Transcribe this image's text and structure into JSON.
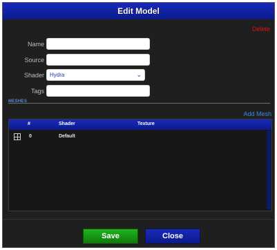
{
  "dialog": {
    "title": "Edit Model",
    "delete_label": "Delete"
  },
  "form": {
    "name_label": "Name",
    "name_value": "",
    "source_label": "Source",
    "source_value": "",
    "shader_label": "Shader",
    "shader_value": "Hydra",
    "tags_label": "Tags",
    "tags_value": ""
  },
  "meshes": {
    "section_label": "MESHES",
    "add_label": "Add Mesh",
    "columns": [
      "#",
      "Shader",
      "Texture"
    ],
    "rows": [
      {
        "index": "0",
        "shader": "Default",
        "texture": ""
      }
    ]
  },
  "footer": {
    "save_label": "Save",
    "close_label": "Close"
  },
  "colors": {
    "accent_blue": "#1a2ab8",
    "save_green": "#22b21f",
    "delete_red": "#e01010"
  },
  "icons": {
    "row_icon": "expand-icon",
    "dropdown": "chevron-down-icon"
  }
}
